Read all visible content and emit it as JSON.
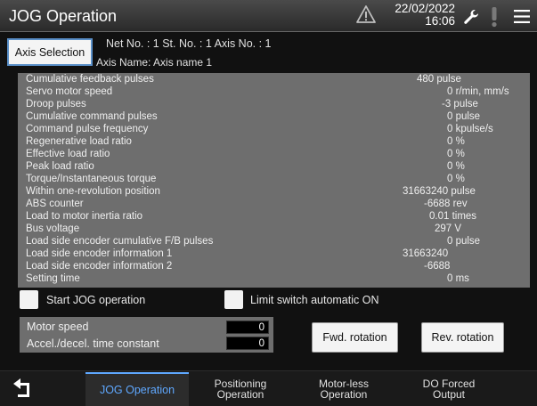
{
  "header": {
    "title": "JOG Operation",
    "date": "22/02/2022",
    "time": "16:06",
    "icons": [
      "warning-triangle-icon",
      "wrench-icon",
      "exclamation-icon",
      "hamburger-menu-icon"
    ]
  },
  "axis": {
    "button_label": "Axis Selection",
    "info": "Net No. :   1    St. No. :   1   Axis No. :  1",
    "name": "Axis Name: Axis name 1"
  },
  "monitor": [
    {
      "label": "Cumulative feedback pulses",
      "value": "480 pulse"
    },
    {
      "label": "Servo motor speed",
      "value": "0 r/min, mm/s"
    },
    {
      "label": "Droop pulses",
      "value": "-3 pulse"
    },
    {
      "label": "Cumulative command pulses",
      "value": "0 pulse"
    },
    {
      "label": "Command pulse frequency",
      "value": "0 kpulse/s"
    },
    {
      "label": "Regenerative load ratio",
      "value": "0 %"
    },
    {
      "label": "Effective load ratio",
      "value": "0 %"
    },
    {
      "label": "Peak load ratio",
      "value": "0 %"
    },
    {
      "label": "Torque/Instantaneous torque",
      "value": "0 %"
    },
    {
      "label": "Within one-revolution position",
      "value": "31663240 pulse"
    },
    {
      "label": "ABS counter",
      "value": "-6688 rev"
    },
    {
      "label": "Load to motor inertia ratio",
      "value": "0.01 times"
    },
    {
      "label": "Bus voltage",
      "value": "297 V"
    },
    {
      "label": "Load side encoder cumulative F/B pulses",
      "value": "0 pulse"
    },
    {
      "label": "Load side encoder information 1",
      "value": "31663240"
    },
    {
      "label": "Load side encoder information 2",
      "value": "-6688"
    },
    {
      "label": "Setting time",
      "value": "0 ms"
    }
  ],
  "options": {
    "start_jog": "Start JOG operation",
    "limit_switch": "Limit switch automatic ON"
  },
  "params": {
    "motor_speed_label": "Motor speed",
    "motor_speed_value": "0",
    "accel_label": "Accel./decel. time constant",
    "accel_value": "0"
  },
  "buttons": {
    "fwd": "Fwd. rotation",
    "rev": "Rev. rotation"
  },
  "tabs": [
    {
      "label": "JOG Operation"
    },
    {
      "label": "Positioning\nOperation"
    },
    {
      "label": "Motor-less\nOperation"
    },
    {
      "label": "DO Forced\nOutput"
    }
  ],
  "colors": {
    "accent": "#5fa8ff",
    "panel": "#6e6e6e",
    "background": "#111111"
  }
}
